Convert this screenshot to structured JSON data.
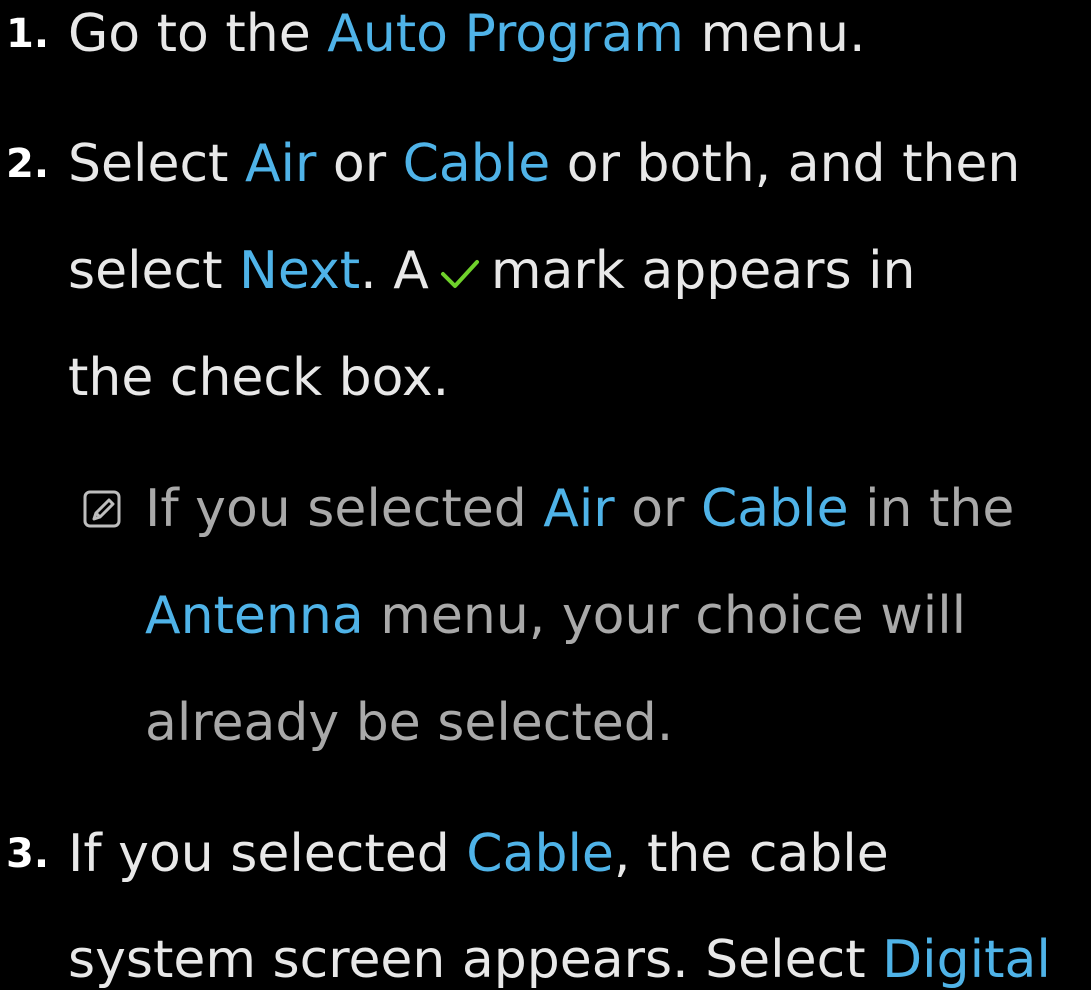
{
  "steps": [
    {
      "number": "1.",
      "lines": [
        [
          {
            "text": "Go to the "
          },
          {
            "text": "Auto Program",
            "highlight": true
          },
          {
            "text": " menu."
          }
        ]
      ]
    },
    {
      "number": "2.",
      "lines": [
        [
          {
            "text": "Select "
          },
          {
            "text": "Air",
            "highlight": true
          },
          {
            "text": " or "
          },
          {
            "text": "Cable",
            "highlight": true
          },
          {
            "text": " or both, and then"
          }
        ],
        [
          {
            "text": "select "
          },
          {
            "text": "Next",
            "highlight": true
          },
          {
            "text": ". A"
          },
          {
            "icon": "checkmark-icon"
          },
          {
            "text": "mark appears in"
          }
        ],
        [
          {
            "text": "the check box."
          }
        ]
      ],
      "note": {
        "icon": "note-icon",
        "lines": [
          [
            {
              "text": "If you selected "
            },
            {
              "text": "Air",
              "highlight": true
            },
            {
              "text": " or "
            },
            {
              "text": "Cable",
              "highlight": true
            },
            {
              "text": " in the"
            }
          ],
          [
            {
              "text": "Antenna",
              "highlight": true
            },
            {
              "text": " menu, your choice will"
            }
          ],
          [
            {
              "text": "already be selected."
            }
          ]
        ]
      }
    },
    {
      "number": "3.",
      "lines": [
        [
          {
            "text": "If you selected "
          },
          {
            "text": "Cable",
            "highlight": true
          },
          {
            "text": ", the cable"
          }
        ],
        [
          {
            "text": "system screen appears. Select "
          },
          {
            "text": "Digital",
            "highlight": true
          }
        ]
      ]
    }
  ],
  "colors": {
    "background": "#000000",
    "text": "#e8e8e8",
    "note_text": "#a9a9a9",
    "highlight": "#4fb3e8",
    "checkmark": "#6fd12b"
  }
}
